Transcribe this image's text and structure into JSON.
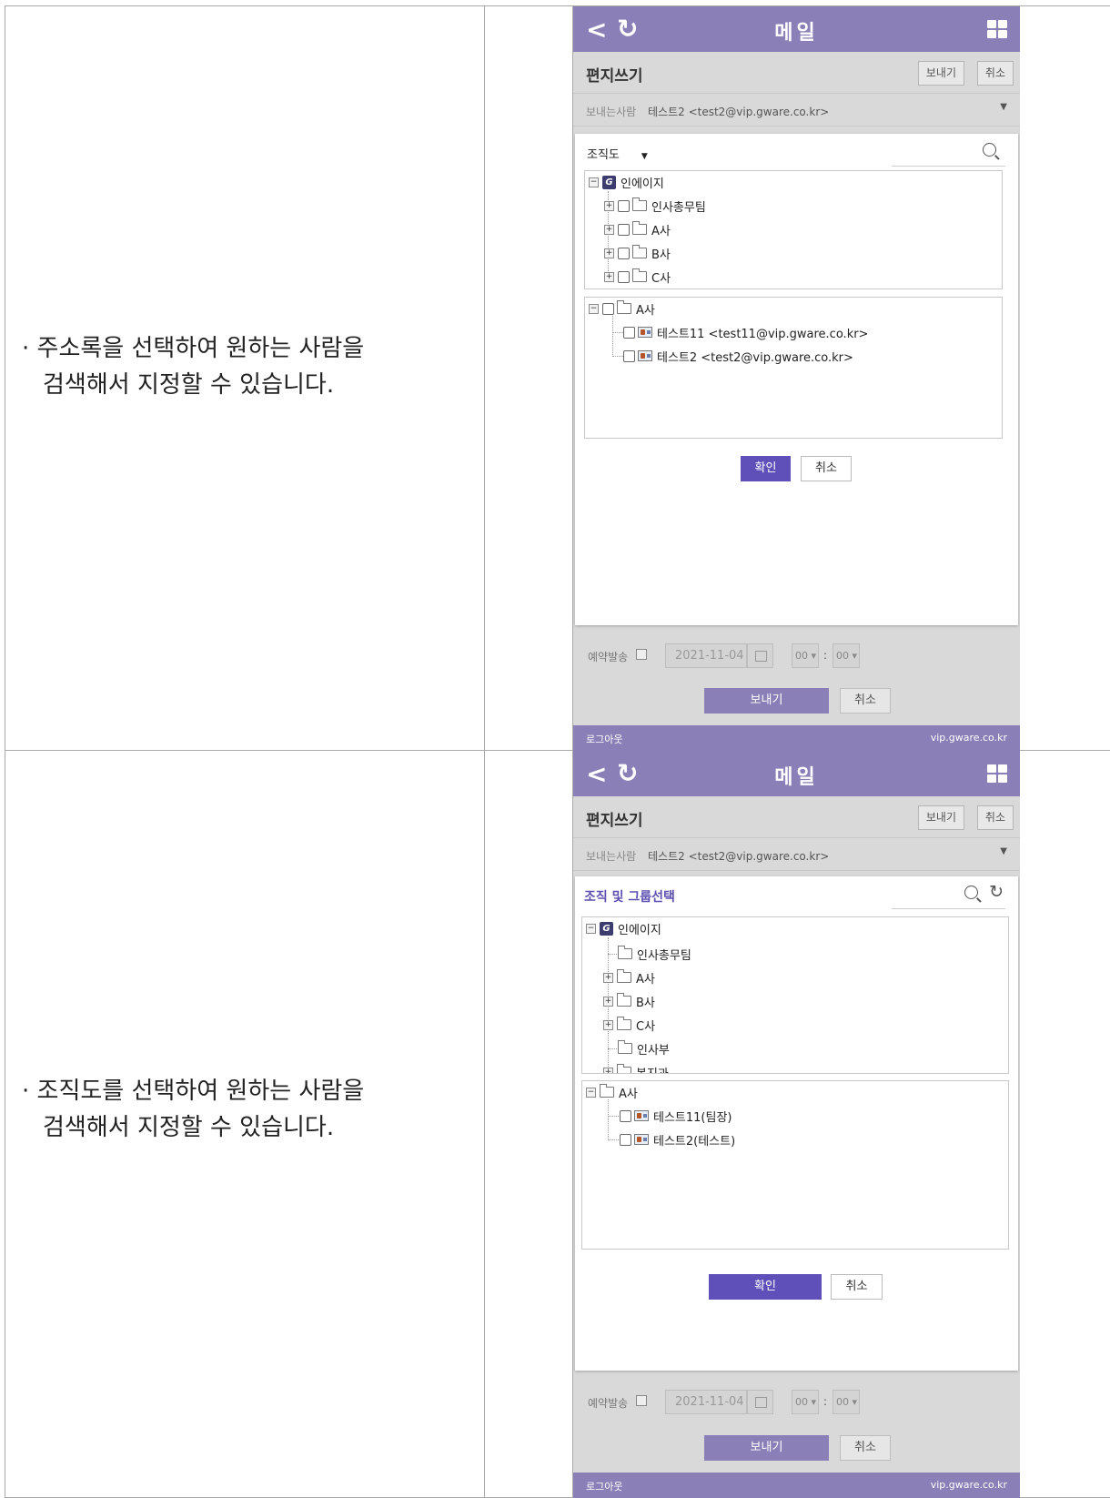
{
  "rows": [
    {
      "description": {
        "line1": "· 주소록을 선택하여 원하는 사람을",
        "line2": "검색해서 지정할 수 있습니다."
      },
      "app": {
        "back_icon": "chevron-left-icon",
        "refresh_icon": "refresh-icon",
        "title": "메일",
        "grid_icon": "grid-icon",
        "compose_title": "편지쓰기",
        "send_label": "보내기",
        "cancel_label": "취소",
        "sender_label": "보내는사람",
        "sender_value": "테스트2 <test2@vip.gware.co.kr>"
      },
      "modal": {
        "dropdown_label": "조직도",
        "tree": [
          {
            "label": "인에이지",
            "type": "root"
          },
          {
            "label": "인사총무팀",
            "type": "folder"
          },
          {
            "label": "A사",
            "type": "folder"
          },
          {
            "label": "B사",
            "type": "folder"
          },
          {
            "label": "C사",
            "type": "folder"
          }
        ],
        "members_group": "A사",
        "members": [
          "테스트11 <test11@vip.gware.co.kr>",
          "테스트2 <test2@vip.gware.co.kr>"
        ],
        "ok_label": "확인",
        "cancel_label": "취소"
      },
      "reservation": {
        "label": "예약발송",
        "date": "2021-11-04",
        "hour": "00",
        "minute": "00"
      },
      "bottom": {
        "send_label": "보내기",
        "cancel_label": "취소"
      },
      "footer": {
        "logout": "로그아웃",
        "domain": "vip.gware.co.kr"
      }
    },
    {
      "description": {
        "line1": "· 조직도를 선택하여 원하는 사람을",
        "line2": "검색해서 지정할 수 있습니다."
      },
      "app": {
        "title": "메일",
        "compose_title": "편지쓰기",
        "send_label": "보내기",
        "cancel_label": "취소",
        "sender_label": "보내는사람",
        "sender_value": "테스트2 <test2@vip.gware.co.kr>"
      },
      "modal": {
        "group_title": "조직 및 그룹선택",
        "tree": [
          {
            "label": "인에이지",
            "type": "root"
          },
          {
            "label": "인사총무팀",
            "type": "folder"
          },
          {
            "label": "A사",
            "type": "folder"
          },
          {
            "label": "B사",
            "type": "folder"
          },
          {
            "label": "C사",
            "type": "folder"
          },
          {
            "label": "인사부",
            "type": "folder"
          },
          {
            "label": "복지과",
            "type": "folder"
          }
        ],
        "members_group": "A사",
        "members": [
          "테스트11(팀장)",
          "테스트2(테스트)"
        ],
        "ok_label": "확인",
        "cancel_label": "취소"
      },
      "reservation": {
        "label": "예약발송",
        "date": "2021-11-04",
        "hour": "00",
        "minute": "00"
      },
      "bottom": {
        "send_label": "보내기",
        "cancel_label": "취소"
      },
      "footer": {
        "logout": "로그아웃",
        "domain": "vip.gware.co.kr"
      }
    }
  ],
  "colors": {
    "header_purple": "#8a7fb6",
    "button_purple": "#5f4fb8",
    "title_purple": "#5b4fb0",
    "overlay_gray": "#d9d9d9"
  }
}
